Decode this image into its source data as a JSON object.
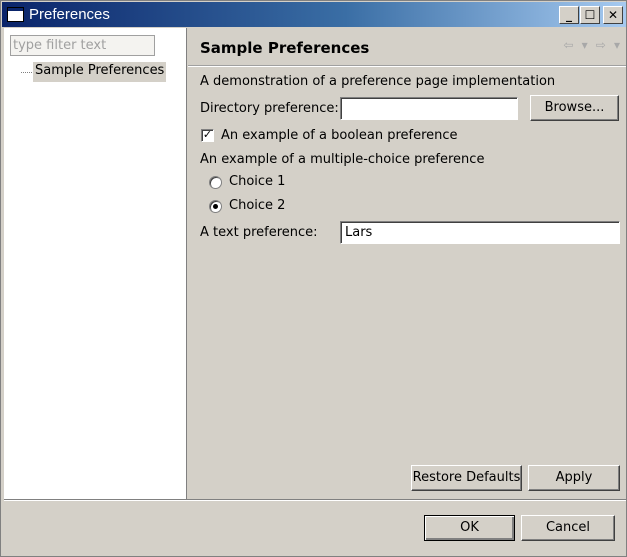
{
  "window": {
    "title": "Preferences",
    "minimize_glyph": "_",
    "maximize_glyph": "☐",
    "close_glyph": "✕"
  },
  "sidebar": {
    "filter_placeholder": "type filter text",
    "filter_value": "",
    "items": [
      {
        "label": "Sample Preferences",
        "selected": true
      }
    ]
  },
  "page": {
    "title": "Sample Preferences",
    "nav_icons": [
      "back-arrow-icon",
      "back-menu-icon",
      "forward-arrow-icon",
      "forward-menu-icon"
    ],
    "description": "A demonstration of a preference page implementation",
    "directory": {
      "label": "Directory preference:",
      "value": "",
      "browse_label": "Browse..."
    },
    "boolean": {
      "label": "An example of a boolean preference",
      "checked": true
    },
    "multiple_choice": {
      "label": "An example of a multiple-choice preference",
      "options": [
        {
          "label": "Choice 1",
          "selected": false
        },
        {
          "label": "Choice 2",
          "selected": true
        }
      ]
    },
    "text_pref": {
      "label": "A text preference:",
      "value": "Lars"
    },
    "restore_defaults_label": "Restore Defaults",
    "apply_label": "Apply"
  },
  "footer": {
    "ok_label": "OK",
    "cancel_label": "Cancel"
  },
  "colors": {
    "titlebar_start": "#0a246a",
    "titlebar_end": "#a6caf0",
    "dialog_bg": "#d4d0c8"
  }
}
